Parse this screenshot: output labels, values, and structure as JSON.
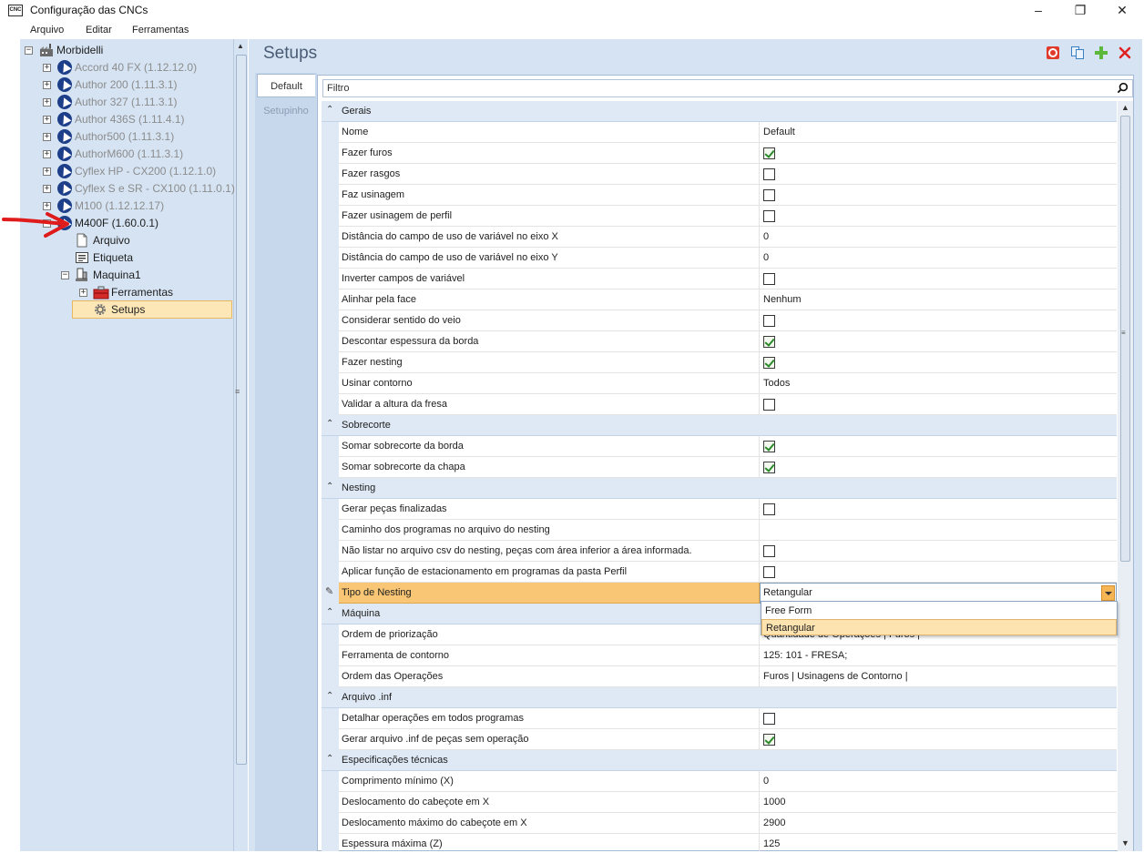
{
  "window": {
    "title": "Configuração das CNCs",
    "icon_text": "CNC",
    "controls": {
      "minimize": "–",
      "maximize": "❐",
      "close": "✕"
    }
  },
  "menu": [
    "Arquivo",
    "Editar",
    "Ferramentas"
  ],
  "tree": {
    "root": "Morbidelli",
    "machines": [
      {
        "label": "Accord 40 FX (1.12.12.0)",
        "enabled": false
      },
      {
        "label": "Author 200 (1.11.3.1)",
        "enabled": false
      },
      {
        "label": "Author 327 (1.11.3.1)",
        "enabled": false
      },
      {
        "label": "Author 436S (1.11.4.1)",
        "enabled": false
      },
      {
        "label": "Author500 (1.11.3.1)",
        "enabled": false
      },
      {
        "label": "AuthorM600 (1.11.3.1)",
        "enabled": false
      },
      {
        "label": "Cyflex HP - CX200 (1.12.1.0)",
        "enabled": false
      },
      {
        "label": "Cyflex S e SR - CX100 (1.11.0.1)",
        "enabled": false
      },
      {
        "label": "M100 (1.12.12.17)",
        "enabled": false
      },
      {
        "label": "M400F (1.60.0.1)",
        "enabled": true
      }
    ],
    "children": {
      "arquivo": "Arquivo",
      "etiqueta": "Etiqueta",
      "maquina": "Maquina1",
      "ferramentas": "Ferramentas",
      "setups": "Setups"
    }
  },
  "panel": {
    "title": "Setups",
    "tabs": [
      "Default",
      "Setupinho"
    ],
    "filter_placeholder": "Filtro"
  },
  "groups": [
    {
      "name": "Gerais",
      "rows": [
        {
          "name": "Nome",
          "type": "text",
          "value": "Default"
        },
        {
          "name": "Fazer furos",
          "type": "check",
          "value": true
        },
        {
          "name": "Fazer rasgos",
          "type": "check",
          "value": false
        },
        {
          "name": "Faz usinagem",
          "type": "check",
          "value": false
        },
        {
          "name": "Fazer usinagem de perfil",
          "type": "check",
          "value": false
        },
        {
          "name": "Distância do campo de uso de variável no eixo X",
          "type": "text",
          "value": "0"
        },
        {
          "name": "Distância do campo de uso de variável no eixo Y",
          "type": "text",
          "value": "0"
        },
        {
          "name": "Inverter campos de variável",
          "type": "check",
          "value": false
        },
        {
          "name": "Alinhar pela face",
          "type": "text",
          "value": "Nenhum"
        },
        {
          "name": "Considerar sentido do veio",
          "type": "check",
          "value": false
        },
        {
          "name": "Descontar espessura da borda",
          "type": "check",
          "value": true
        },
        {
          "name": "Fazer nesting",
          "type": "check",
          "value": true
        },
        {
          "name": "Usinar contorno",
          "type": "text",
          "value": "Todos"
        },
        {
          "name": "Validar a altura da fresa",
          "type": "check",
          "value": false
        }
      ]
    },
    {
      "name": "Sobrecorte",
      "rows": [
        {
          "name": "Somar sobrecorte da borda",
          "type": "check",
          "value": true
        },
        {
          "name": "Somar sobrecorte da chapa",
          "type": "check",
          "value": true
        }
      ]
    },
    {
      "name": "Nesting",
      "rows": [
        {
          "name": "Gerar peças finalizadas",
          "type": "check",
          "value": false
        },
        {
          "name": "Caminho dos programas no arquivo do nesting",
          "type": "text",
          "value": ""
        },
        {
          "name": "Não listar no arquivo csv do nesting, peças com área inferior a área informada.",
          "type": "check",
          "value": false
        },
        {
          "name": "Aplicar função de estacionamento em programas da pasta Perfil",
          "type": "check",
          "value": false
        },
        {
          "name": "Tipo de Nesting",
          "type": "combo",
          "value": "Retangular",
          "active": true
        }
      ]
    },
    {
      "name": "Máquina",
      "rows": [
        {
          "name": "Ordem de priorização",
          "type": "text",
          "value": "Quantidade de Operações | Furos |"
        },
        {
          "name": "Ferramenta de contorno",
          "type": "text",
          "value": "125: 101 - FRESA;"
        },
        {
          "name": "Ordem das Operações",
          "type": "text",
          "value": "Furos | Usinagens de Contorno |"
        }
      ]
    },
    {
      "name": "Arquivo .inf",
      "rows": [
        {
          "name": "Detalhar operações em todos programas",
          "type": "check",
          "value": false
        },
        {
          "name": "Gerar arquivo .inf de peças sem operação",
          "type": "check",
          "value": true
        }
      ]
    },
    {
      "name": "Especificações técnicas",
      "rows": [
        {
          "name": "Comprimento mínimo (X)",
          "type": "text",
          "value": "0"
        },
        {
          "name": "Deslocamento do cabeçote em X",
          "type": "text",
          "value": "1000"
        },
        {
          "name": "Deslocamento máximo do cabeçote em X",
          "type": "text",
          "value": "2900"
        },
        {
          "name": "Espessura máxima (Z)",
          "type": "text",
          "value": "125"
        }
      ]
    }
  ],
  "dropdown": {
    "options": [
      "Free Form",
      "Retangular"
    ],
    "selected": "Retangular"
  },
  "colors": {
    "panel_bg": "#d5e3f3",
    "active_row": "#f8c675",
    "selected_tree": "#fde7b7",
    "annotation_arrow": "#e01b1b"
  }
}
